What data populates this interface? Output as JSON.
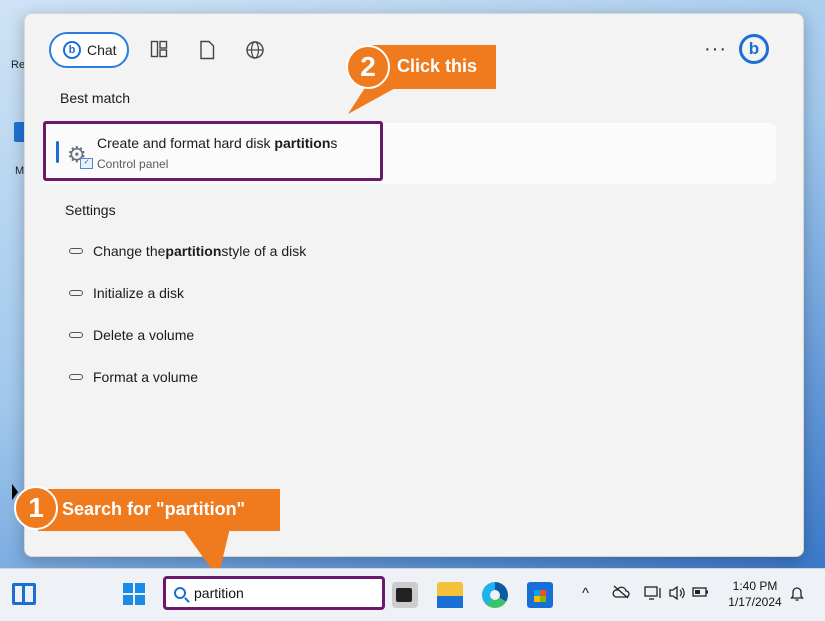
{
  "desktop": {
    "label_re": "Re",
    "label_m": "M"
  },
  "start_menu": {
    "chat_label": "Chat",
    "bing_glyph": "b",
    "more_glyph": "···",
    "toolbar_icons": [
      "apps-grid-icon",
      "document-icon",
      "globe-icon"
    ],
    "best_match_heading": "Best match",
    "best_match": {
      "title_prefix": "Create and format hard disk ",
      "title_bold": "partition",
      "title_suffix": "s",
      "subtitle": "Control panel",
      "icon": "settings-gear-icon"
    },
    "settings_heading": "Settings",
    "settings_items": [
      {
        "prefix": "Change the ",
        "bold": "partition",
        "suffix": " style of a disk"
      },
      {
        "prefix": "Initialize a disk",
        "bold": "",
        "suffix": ""
      },
      {
        "prefix": "Delete a volume",
        "bold": "",
        "suffix": ""
      },
      {
        "prefix": "Format a volume",
        "bold": "",
        "suffix": ""
      }
    ]
  },
  "callouts": {
    "step1_number": "1",
    "step1_text": "Search for \"partition\"",
    "step2_number": "2",
    "step2_text": "Click this",
    "color": "#f07b1e",
    "highlight_color": "#6b1a6b"
  },
  "taskbar": {
    "search_value": "partition",
    "tray_chevron": "^",
    "time": "1:40 PM",
    "date": "1/17/2024"
  }
}
